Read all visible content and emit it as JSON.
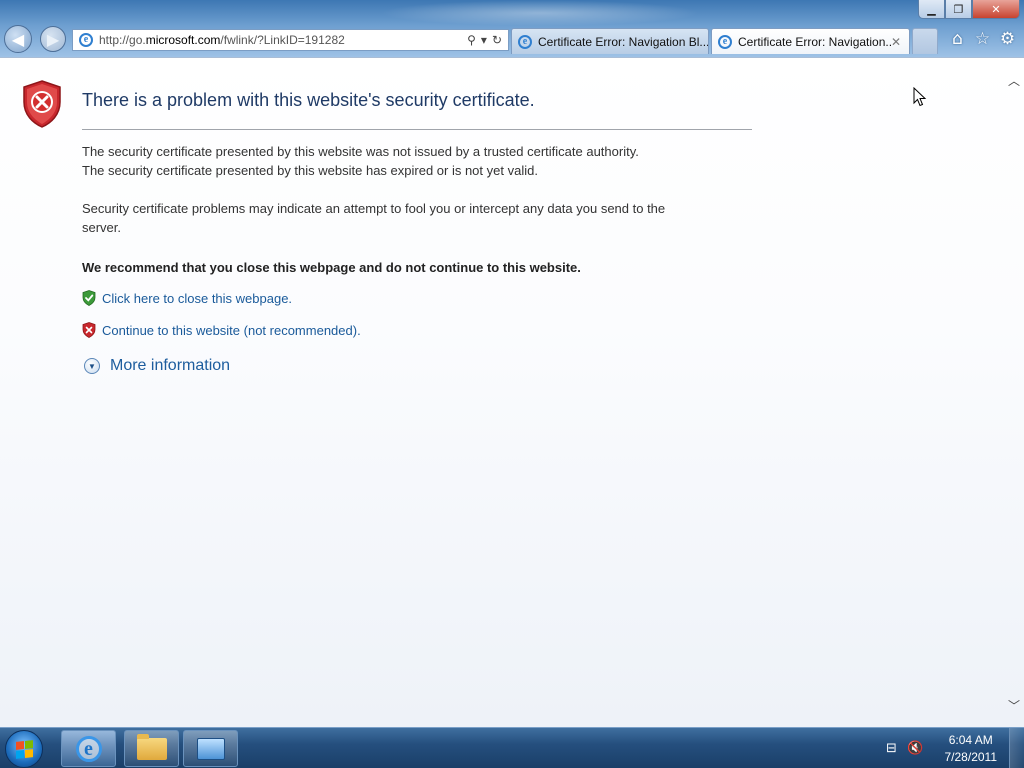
{
  "window": {
    "minimize_label": "▁",
    "restore_label": "❐",
    "close_label": "✕"
  },
  "browser": {
    "url_prefix": "http://go.",
    "url_domain": "microsoft.com",
    "url_path": "/fwlink/?LinkID=191282",
    "search_icon": "search-icon",
    "refresh_icon": "refresh-icon",
    "tabs": [
      {
        "label": "Certificate Error: Navigation Bl...",
        "active": false
      },
      {
        "label": "Certificate Error: Navigation...",
        "active": true,
        "close": "✕"
      }
    ],
    "tool_icons": [
      "home-icon",
      "favorites-star-icon",
      "settings-gear-icon"
    ]
  },
  "page": {
    "title": "There is a problem with this website's security certificate.",
    "para1_line1": "The security certificate presented by this website was not issued by a trusted certificate authority.",
    "para1_line2": "The security certificate presented by this website has expired or is not yet valid.",
    "para2_line1": "Security certificate problems may indicate an attempt to fool you or intercept any data you send to the",
    "para2_line2": "server.",
    "recommendation": "We recommend that you close this webpage and do not continue to this website.",
    "close_link": "Click here to close this webpage.",
    "continue_link": "Continue to this website (not recommended).",
    "more_info": "More information"
  },
  "taskbar": {
    "time": "6:04 AM",
    "date": "7/28/2011",
    "pinned": [
      "internet-explorer",
      "windows-explorer",
      "network-app"
    ]
  },
  "colors": {
    "title": "#1f3a66",
    "link": "#1a5a9a",
    "shield_red": "#c8272d",
    "shield_green": "#3c9a3a",
    "taskbar": "#254f7e"
  }
}
